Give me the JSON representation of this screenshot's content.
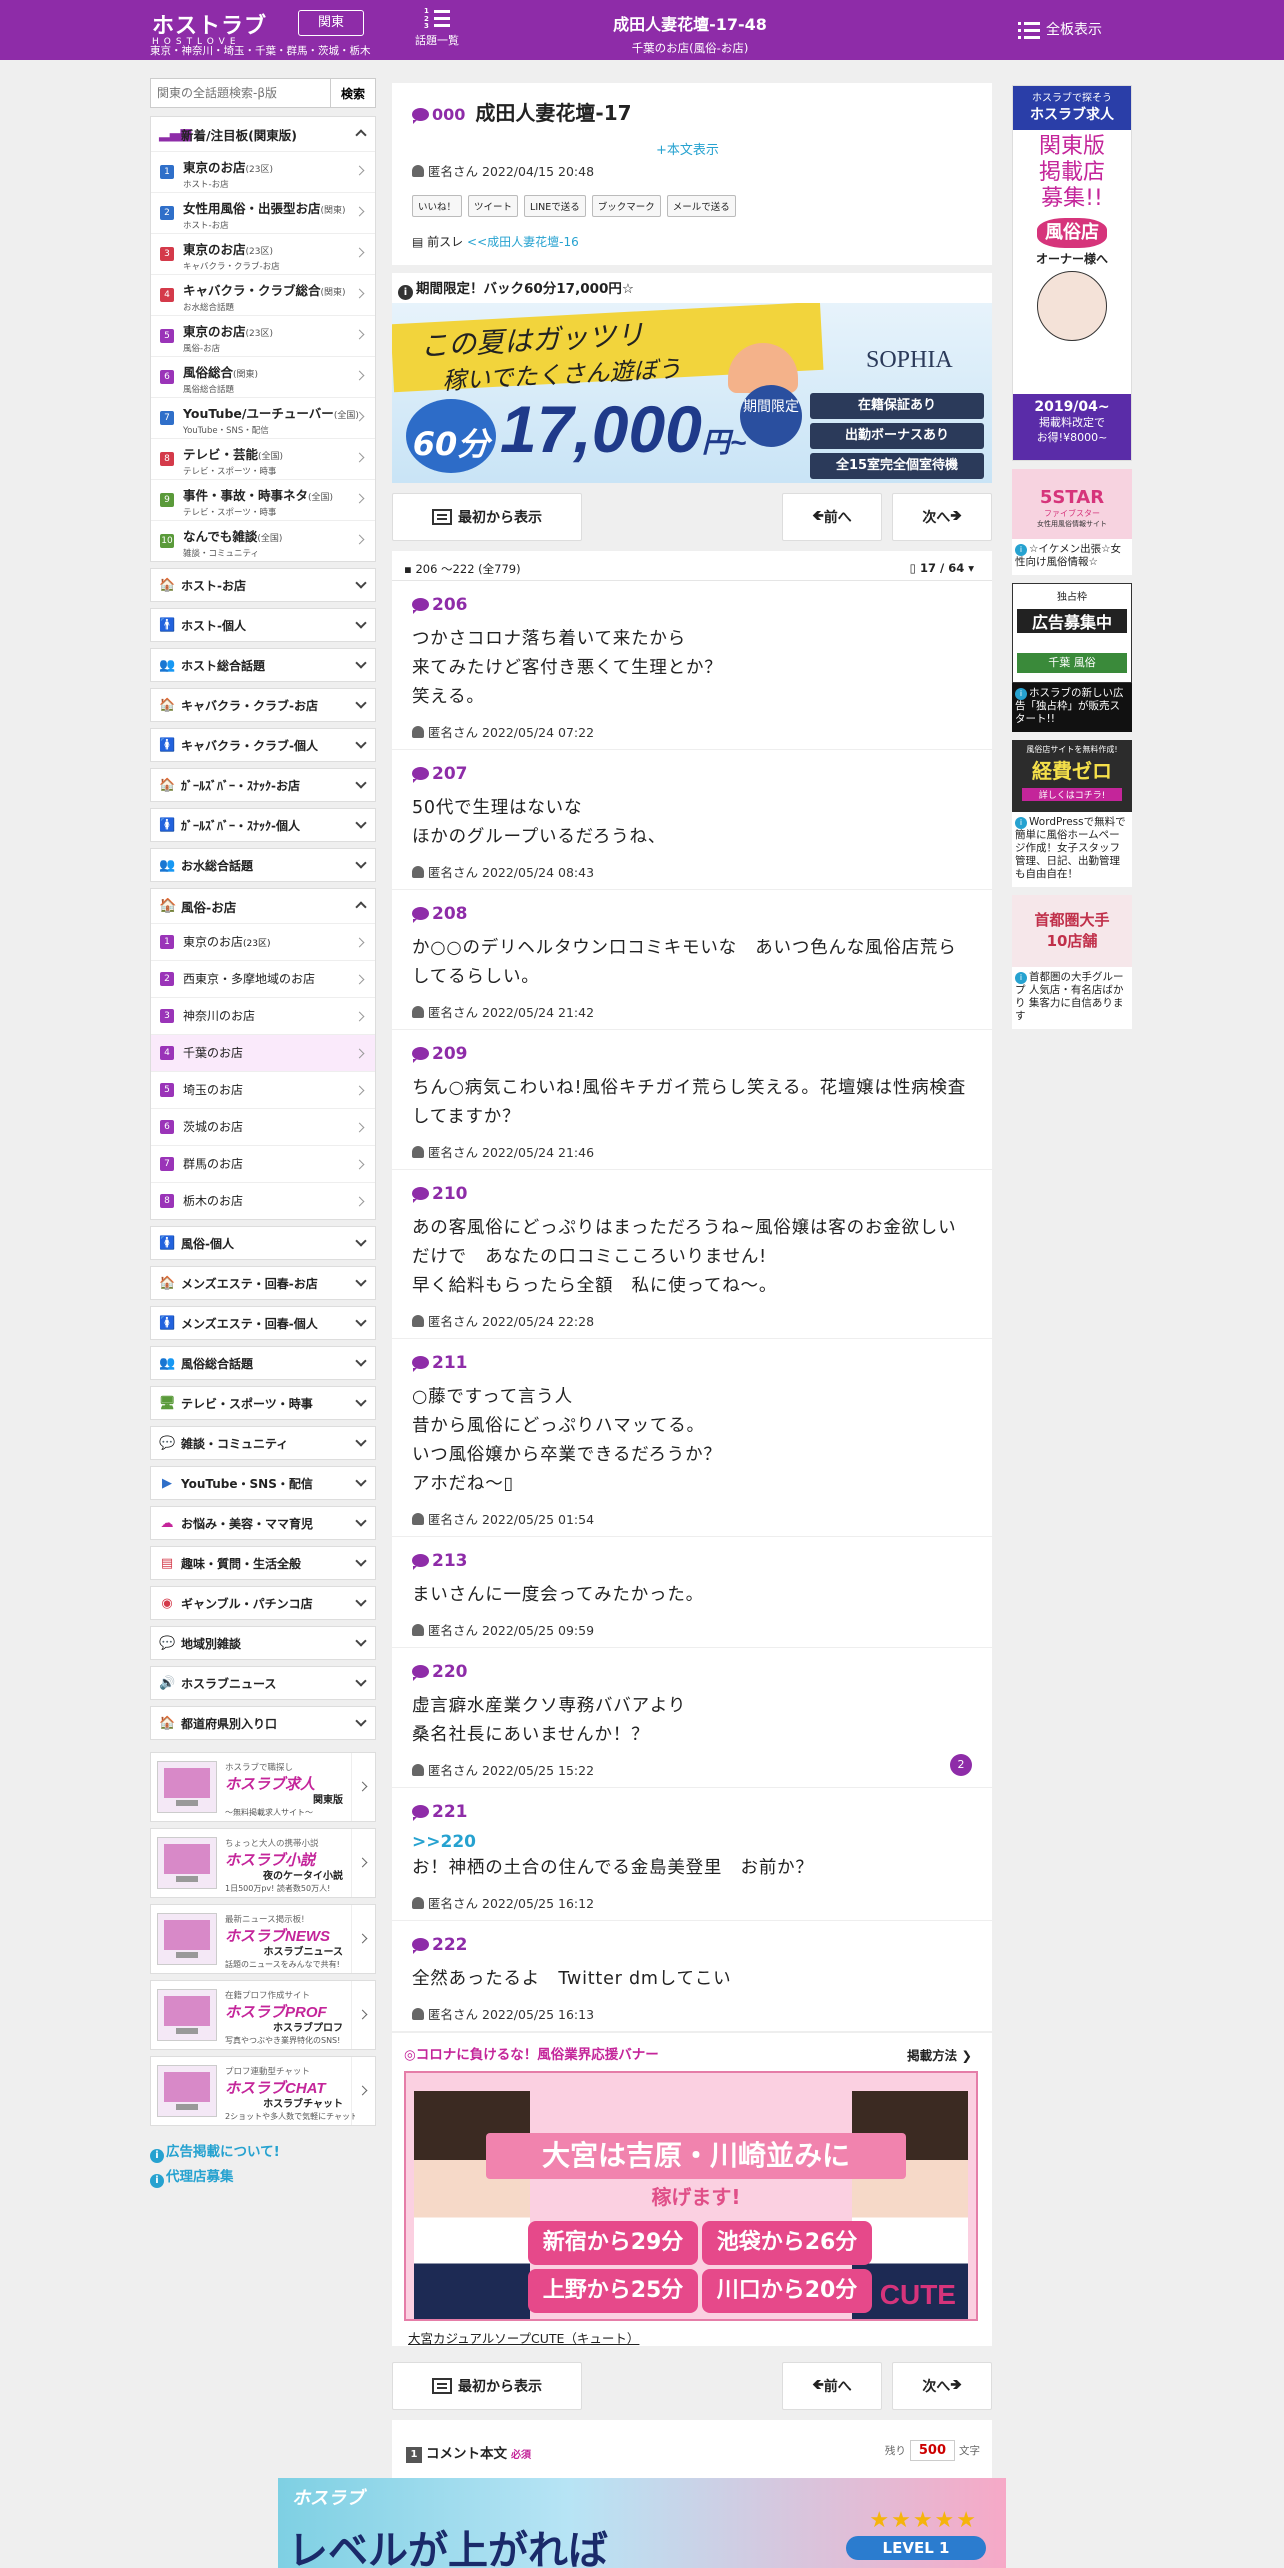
{
  "header": {
    "logo_text": "ホストラブ",
    "logo_sub": "HOSTLOVE",
    "region_button": "関東",
    "areas": "東京・神奈川・埼玉・千葉・群馬・茨城・栃木",
    "topics_label": "話題一覧",
    "title": "成田人妻花壇-17-48",
    "subtitle": "千葉のお店(風俗-お店)",
    "all_boards": "全板表示"
  },
  "search": {
    "placeholder": "関東の全話題検索-β版",
    "button": "検索"
  },
  "sidebar": {
    "new_attention": {
      "heading": "新着/注目板(関東版)",
      "items": [
        {
          "n": "1",
          "name": "東京のお店",
          "scope": "(23区)",
          "desc": "ホスト-お店",
          "color": "#2f6fc9"
        },
        {
          "n": "2",
          "name": "女性用風俗・出張型お店",
          "scope": "(関東)",
          "desc": "ホスト-お店",
          "color": "#2f6fc9"
        },
        {
          "n": "3",
          "name": "東京のお店",
          "scope": "(23区)",
          "desc": "キャバクラ・クラブ-お店",
          "color": "#d43a4a"
        },
        {
          "n": "4",
          "name": "キャバクラ・クラブ総合",
          "scope": "(関東)",
          "desc": "お水総合話題",
          "color": "#d43a4a"
        },
        {
          "n": "5",
          "name": "東京のお店",
          "scope": "(23区)",
          "desc": "風俗-お店",
          "color": "#9a34b8"
        },
        {
          "n": "6",
          "name": "風俗総合",
          "scope": "(関東)",
          "desc": "風俗総合話題",
          "color": "#9a34b8"
        },
        {
          "n": "7",
          "name": "YouTube/ユーチューバー",
          "scope": "(全国)",
          "desc": "YouTube・SNS・配信",
          "color": "#2f6fc9"
        },
        {
          "n": "8",
          "name": "テレビ・芸能",
          "scope": "(全国)",
          "desc": "テレビ・スポーツ・時事",
          "color": "#d43a4a"
        },
        {
          "n": "9",
          "name": "事件・事故・時事ネタ",
          "scope": "(全国)",
          "desc": "テレビ・スポーツ・時事",
          "color": "#5a9a3a"
        },
        {
          "n": "10",
          "name": "なんでも雑談",
          "scope": "(全国)",
          "desc": "雑談・コミュニティ",
          "color": "#5a9a3a"
        }
      ]
    },
    "cats_a": [
      {
        "label": "ホスト-お店",
        "icon": "🏠",
        "color": "#2f6fc9"
      },
      {
        "label": "ホスト-個人",
        "icon": "🚹",
        "color": "#2f6fc9"
      },
      {
        "label": "ホスト総合話題",
        "icon": "👥",
        "color": "#2f6fc9"
      },
      {
        "label": "キャバクラ・クラブ-お店",
        "icon": "🏠",
        "color": "#d43a4a"
      },
      {
        "label": "キャバクラ・クラブ-個人",
        "icon": "🚺",
        "color": "#d43a4a"
      },
      {
        "label": "ｶﾞｰﾙｽﾞﾊﾞｰ・ｽﾅｯｸ-お店",
        "icon": "🏠",
        "color": "#d43a4a"
      },
      {
        "label": "ｶﾞｰﾙｽﾞﾊﾞｰ・ｽﾅｯｸ-個人",
        "icon": "🚺",
        "color": "#d43a4a"
      },
      {
        "label": "お水総合話題",
        "icon": "👥",
        "color": "#d43a4a"
      }
    ],
    "fuzoku_shop": {
      "heading": "風俗-お店",
      "items": [
        {
          "n": "1",
          "name": "東京のお店",
          "scope": "(23区)"
        },
        {
          "n": "2",
          "name": "西東京・多摩地域のお店",
          "scope": ""
        },
        {
          "n": "3",
          "name": "神奈川のお店",
          "scope": ""
        },
        {
          "n": "4",
          "name": "千葉のお店",
          "scope": ""
        },
        {
          "n": "5",
          "name": "埼玉のお店",
          "scope": ""
        },
        {
          "n": "6",
          "name": "茨城のお店",
          "scope": ""
        },
        {
          "n": "7",
          "name": "群馬のお店",
          "scope": ""
        },
        {
          "n": "8",
          "name": "栃木のお店",
          "scope": ""
        }
      ]
    },
    "cats_b": [
      {
        "label": "風俗-個人",
        "icon": "🚺",
        "color": "#9a34b8"
      },
      {
        "label": "メンズエステ・回春-お店",
        "icon": "🏠",
        "color": "#9a34b8"
      },
      {
        "label": "メンズエステ・回春-個人",
        "icon": "🚺",
        "color": "#9a34b8"
      },
      {
        "label": "風俗総合話題",
        "icon": "👥",
        "color": "#9a34b8"
      },
      {
        "label": "テレビ・スポーツ・時事",
        "icon": "🖥",
        "color": "#5a9a3a"
      },
      {
        "label": "雑談・コミュニティ",
        "icon": "💬",
        "color": "#5a9a3a"
      },
      {
        "label": "YouTube・SNS・配信",
        "icon": "▶",
        "color": "#2f6fc9"
      },
      {
        "label": "お悩み・美容・ママ育児",
        "icon": "☁",
        "color": "#c4259a"
      },
      {
        "label": "趣味・質問・生活全般",
        "icon": "▤",
        "color": "#d43a4a"
      },
      {
        "label": "ギャンブル・パチンコ店",
        "icon": "◉",
        "color": "#d43a4a"
      },
      {
        "label": "地域別雑談",
        "icon": "💬",
        "color": "#26a2d0"
      },
      {
        "label": "ホスラブニュース",
        "icon": "🔊",
        "color": "#333"
      },
      {
        "label": "都道府県別入り口",
        "icon": "🏠",
        "color": "#26a2d0"
      }
    ],
    "services": [
      {
        "tag": "ホスラブで職探し",
        "title": "ホスラブ求人",
        "name": "関東版",
        "desc": "〜無料掲載求人サイト〜"
      },
      {
        "tag": "ちょっと大人の携帯小説",
        "title": "ホスラブ小説",
        "name": "夜のケータイ小説",
        "desc": "1日500万pv! 読者数50万人!"
      },
      {
        "tag": "最新ニュース掲示板!",
        "title": "ホスラブNEWS",
        "name": "ホスラブニュース",
        "desc": "話題のニュースをみんなで共有!"
      },
      {
        "tag": "在籍プロフ作成サイト",
        "title": "ホスラブPROF",
        "name": "ホスラブプロフ",
        "desc": "写真やつぶやき業界特化のSNS!"
      },
      {
        "tag": "プロフ連動型チャット",
        "title": "ホスラブCHAT",
        "name": "ホスラブチャット",
        "desc": "2ショットや多人数で気軽にチャット"
      }
    ],
    "info_links": [
      "広告掲載について!",
      "代理店募集"
    ]
  },
  "thread": {
    "num": "000",
    "title": "成田人妻花壇-17",
    "more": "+本文表示",
    "author": "匿名さん",
    "date": "2022/04/15 20:48",
    "shares": [
      "いいね！",
      "ツイート",
      "LINEで送る",
      "ブックマーク",
      "メールで送る"
    ],
    "prev_label": "前スレ",
    "prev_link": "<<成田人妻花壇-16"
  },
  "promo": {
    "heading": "期間限定！バック60分17,000円☆",
    "hand1": "この夏はガッツリ",
    "hand2": "稼いでたくさん遊ぼう",
    "big": "17,000",
    "big_unit": "円~",
    "circle": "60分",
    "limited": "期間限定",
    "brand": "SOPHIA",
    "pills": [
      "在籍保証あり",
      "出勤ボーナスあり",
      "全15室完全個室待機"
    ]
  },
  "nav": {
    "first": "最初から表示",
    "prev": "前へ",
    "next": "次へ"
  },
  "posts_header": {
    "range": "206 ～222 (全779)",
    "page": "17 / 64"
  },
  "posts": [
    {
      "num": "206",
      "body": "つかさコロナ落ち着いて来たから\n来てみたけど客付き悪くて生理とか？\n笑える。",
      "author": "匿名さん",
      "date": "2022/05/24 07:22",
      "badge": ""
    },
    {
      "num": "207",
      "body": "50代で生理はないな\nほかのグループいるだろうね、",
      "author": "匿名さん",
      "date": "2022/05/24 08:43",
      "badge": ""
    },
    {
      "num": "208",
      "body": "か○○のデリヘルタウン口コミキモいな　あいつ色んな風俗店荒らしてるらしい。",
      "author": "匿名さん",
      "date": "2022/05/24 21:42",
      "badge": ""
    },
    {
      "num": "209",
      "body": "ちん○病気こわいね!風俗キチガイ荒らし笑える。花壇嬢は性病検査してますか？",
      "author": "匿名さん",
      "date": "2022/05/24 21:46",
      "badge": ""
    },
    {
      "num": "210",
      "body": "あの客風俗にどっぷりはまっただろうね~風俗嬢は客のお金欲しいだけで　あなたの口コミこころいりません!\n早く給料もらったら全額　私に使ってね～。",
      "author": "匿名さん",
      "date": "2022/05/24 22:28",
      "badge": ""
    },
    {
      "num": "211",
      "body": "○藤ですって言う人\n昔から風俗にどっぷりハマッてる。\nいつ風俗嬢から卒業できるだろうか？\nアホだね～▯",
      "author": "匿名さん",
      "date": "2022/05/25 01:54",
      "badge": ""
    },
    {
      "num": "213",
      "body": "まいさんに一度会ってみたかった。",
      "author": "匿名さん",
      "date": "2022/05/25 09:59",
      "badge": ""
    },
    {
      "num": "220",
      "body": "虚言癖水産業クソ専務ババアより\n桑名社長にあいませんか！？",
      "author": "匿名さん",
      "date": "2022/05/25 15:22",
      "badge": "2"
    },
    {
      "num": "221",
      "anchor": ">>220",
      "body": "お！神栖の土合の住んでる金島美登里　お前か？",
      "author": "匿名さん",
      "date": "2022/05/25 16:12",
      "badge": ""
    },
    {
      "num": "222",
      "body": "全然あったるよ　Twitter dmしてこい",
      "author": "匿名さん",
      "date": "2022/05/25 16:13",
      "badge": ""
    }
  ],
  "support_ad": {
    "heading": "◎コロナに負けるな！風俗業界応援バナー",
    "method": "掲載方法",
    "headline": "大宮は吉原・川崎並みに",
    "sub": "稼げます!",
    "cells": [
      "新宿から29分",
      "池袋から26分",
      "上野から25分",
      "川口から20分"
    ],
    "brand": "CUTE",
    "caption": "大宮カジュアルソープCUTE（キュート）"
  },
  "comment_form": {
    "n": "1",
    "label": "コメント本文",
    "required": "必須",
    "remain_label": "残り",
    "remain": "500",
    "unit": "文字"
  },
  "right_ads": [
    {
      "lines": [
        "ホスラブで探そう",
        "ホスラブ求人",
        "関東版",
        "掲載店",
        "募集!!",
        "風俗店",
        "オーナー様へ",
        "2019/04~",
        "掲載料改定で",
        "お得!¥8000~"
      ]
    },
    {
      "top": "5STAR",
      "sub": "ファイブスター",
      "sub2": "女性用風俗情報サイト",
      "txt": "☆イケメン出張☆女性向け風俗情報☆"
    },
    {
      "top": "広告募集中",
      "sub": "独占枠",
      "sub2": "千葉 風俗",
      "txt": "ホスラブの新しい広告「独占枠」が販売スタート!!"
    },
    {
      "top": "経費ゼロ",
      "sub": "風俗店サイトを無料作成!",
      "sub2": "詳しくはコチラ!",
      "txt": "WordPressで無料で簡単に風俗ホームページ作成！女子スタッフ管理、日記、出勤管理も自由自在！"
    },
    {
      "top": "首都圏大手",
      "sub": "10店舗",
      "txt": "首都圏の大手グループ 人気店・有名店ばかり 集客力に自信あります"
    }
  ],
  "bottom_banner": {
    "logo": "ホスラブ",
    "text": "レベルが上がれば",
    "level": "LEVEL 1",
    "stars": "★★★★★"
  }
}
